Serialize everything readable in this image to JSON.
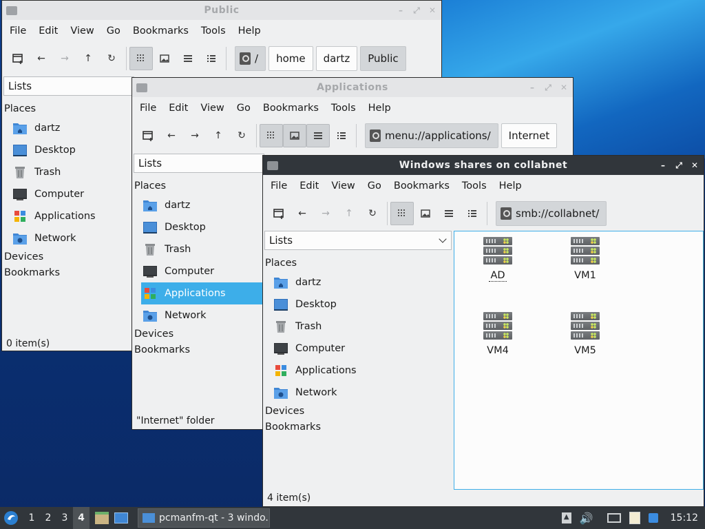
{
  "windows": {
    "public": {
      "title": "Public",
      "menu": [
        "File",
        "Edit",
        "View",
        "Go",
        "Bookmarks",
        "Tools",
        "Help"
      ],
      "crumbs": [
        "/",
        "home",
        "dartz",
        "Public"
      ],
      "side_mode": "Lists",
      "places_label": "Places",
      "places": [
        "dartz",
        "Desktop",
        "Trash",
        "Computer",
        "Applications",
        "Network"
      ],
      "devices_label": "Devices",
      "bookmarks_label": "Bookmarks",
      "status": "0 item(s)"
    },
    "applications": {
      "title": "Applications",
      "menu": [
        "File",
        "Edit",
        "View",
        "Go",
        "Bookmarks",
        "Tools",
        "Help"
      ],
      "path": "menu://applications/",
      "crumb_extra": "Internet",
      "side_mode": "Lists",
      "places_label": "Places",
      "places": [
        "dartz",
        "Desktop",
        "Trash",
        "Computer",
        "Applications",
        "Network"
      ],
      "selected_place": "Applications",
      "devices_label": "Devices",
      "bookmarks_label": "Bookmarks",
      "status": "\"Internet\" folder"
    },
    "shares": {
      "title": "Windows shares on collabnet",
      "menu": [
        "File",
        "Edit",
        "View",
        "Go",
        "Bookmarks",
        "Tools",
        "Help"
      ],
      "path": "smb://collabnet/",
      "side_mode": "Lists",
      "places_label": "Places",
      "places": [
        "dartz",
        "Desktop",
        "Trash",
        "Computer",
        "Applications",
        "Network"
      ],
      "devices_label": "Devices",
      "bookmarks_label": "Bookmarks",
      "servers": [
        "AD",
        "VM1",
        "VM4",
        "VM5"
      ],
      "status": "4 item(s)"
    }
  },
  "taskbar": {
    "workspaces": [
      "1",
      "2",
      "3",
      "4"
    ],
    "active_workspace": "4",
    "task_label": "pcmanfm-qt - 3 windo...",
    "clock": "15:12"
  },
  "colors": {
    "accent": "#3daee9",
    "titlebar_active": "#31363b",
    "panel": "#31363b"
  }
}
